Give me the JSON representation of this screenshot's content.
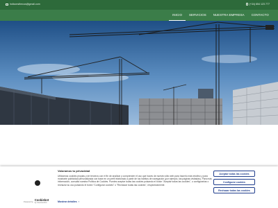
{
  "topbar": {
    "email": "indiconsthecus@gmail.com",
    "phone": "(+34) 654 123 777"
  },
  "nav": {
    "items": [
      "INICIO",
      "SERVICIOS",
      "NUESTRA EMPRESA",
      "CONTACTO"
    ],
    "active": "INICIO"
  },
  "cookie_banner": {
    "title": "Valoramos tu privacidad",
    "text": "Utilizamos cookies propias y de terceros con el fin de analizar y comprender el uso que haces de nuestro sitio web para hacerlo más intuitivo y para mostrarte publicidad personalizada con base en un perfil elaborado a partir de tus hábitos de navegación (por ejemplo, las páginas visitadas). Para más información, consulta nuestra Política de Cookies. Puedes aceptar todas las cookies pulsando el botón \"Aceptar todas las cookies\", o configurarlas o rechazar su uso pulsando el botón \"Configurar cookies\" o \"Rechazar todas las cookies\", respectivamente.",
    "powered_by": "Powered by",
    "brand": "Cookiebot",
    "brand_sub": "by Usercentrics",
    "details_label": "Mostrar detalles",
    "accept_label": "Aceptar todas las cookies",
    "configure_label": "Configurar cookies",
    "reject_label": "Rechazar todas las cookies"
  },
  "colors": {
    "topbar": "#2d6a3a",
    "navbar": "#3b7d49",
    "button_border": "#1f3d8c"
  }
}
